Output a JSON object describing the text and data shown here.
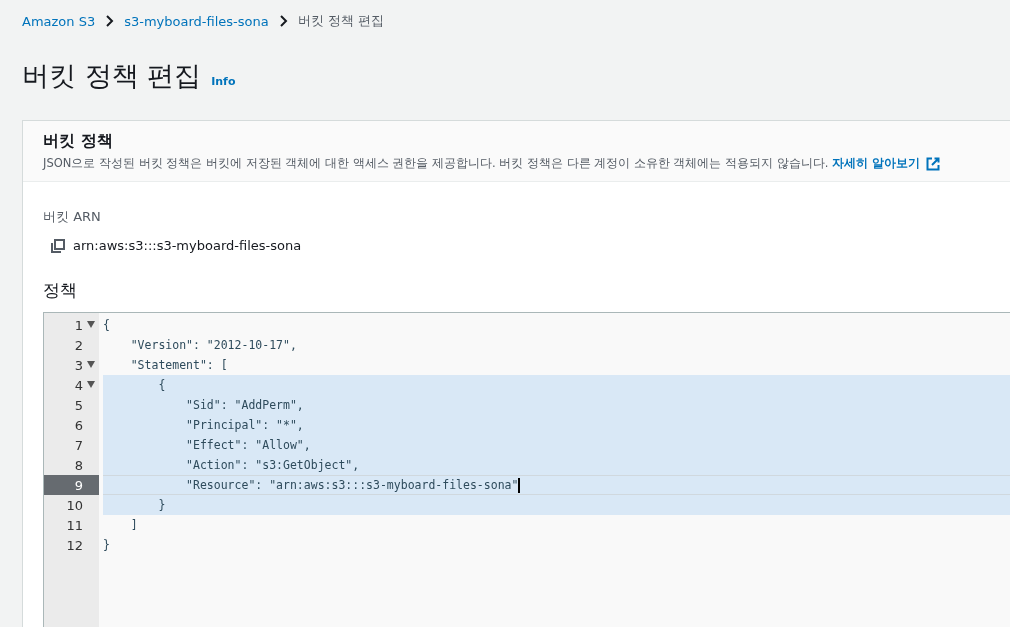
{
  "breadcrumbs": [
    {
      "label": "Amazon S3",
      "link": true
    },
    {
      "label": "s3-myboard-files-sona",
      "link": true
    },
    {
      "label": "버킷 정책 편집",
      "link": false
    }
  ],
  "page": {
    "title": "버킷 정책 편집",
    "info": "Info"
  },
  "card": {
    "title": "버킷 정책",
    "description": "JSON으로 작성된 버킷 정책은 버킷에 저장된 객체에 대한 액세스 권한을 제공합니다. 버킷 정책은 다른 계정이 소유한 객체에는 적용되지 않습니다.",
    "learn_more": "자세히 알아보기",
    "arn_label": "버킷 ARN",
    "arn": "arn:aws:s3:::s3-myboard-files-sona",
    "policy_label": "정책"
  },
  "editor": {
    "lines": [
      {
        "number": "1",
        "text": "{",
        "foldable": true,
        "highlighted": false,
        "active": false
      },
      {
        "number": "2",
        "text": "    \"Version\": \"2012-10-17\",",
        "foldable": false,
        "highlighted": false,
        "active": false
      },
      {
        "number": "3",
        "text": "    \"Statement\": [",
        "foldable": true,
        "highlighted": false,
        "active": false
      },
      {
        "number": "4",
        "text": "        {",
        "foldable": true,
        "highlighted": true,
        "active": false
      },
      {
        "number": "5",
        "text": "            \"Sid\": \"AddPerm\",",
        "foldable": false,
        "highlighted": true,
        "active": false
      },
      {
        "number": "6",
        "text": "            \"Principal\": \"*\",",
        "foldable": false,
        "highlighted": true,
        "active": false
      },
      {
        "number": "7",
        "text": "            \"Effect\": \"Allow\",",
        "foldable": false,
        "highlighted": true,
        "active": false
      },
      {
        "number": "8",
        "text": "            \"Action\": \"s3:GetObject\",",
        "foldable": false,
        "highlighted": true,
        "active": false
      },
      {
        "number": "9",
        "text": "            \"Resource\": \"arn:aws:s3:::s3-myboard-files-sona\"",
        "foldable": false,
        "highlighted": true,
        "active": true
      },
      {
        "number": "10",
        "text": "        }",
        "foldable": false,
        "highlighted": true,
        "active": false
      },
      {
        "number": "11",
        "text": "    ]",
        "foldable": false,
        "highlighted": false,
        "active": false
      },
      {
        "number": "12",
        "text": "}",
        "foldable": false,
        "highlighted": false,
        "active": false
      }
    ]
  }
}
